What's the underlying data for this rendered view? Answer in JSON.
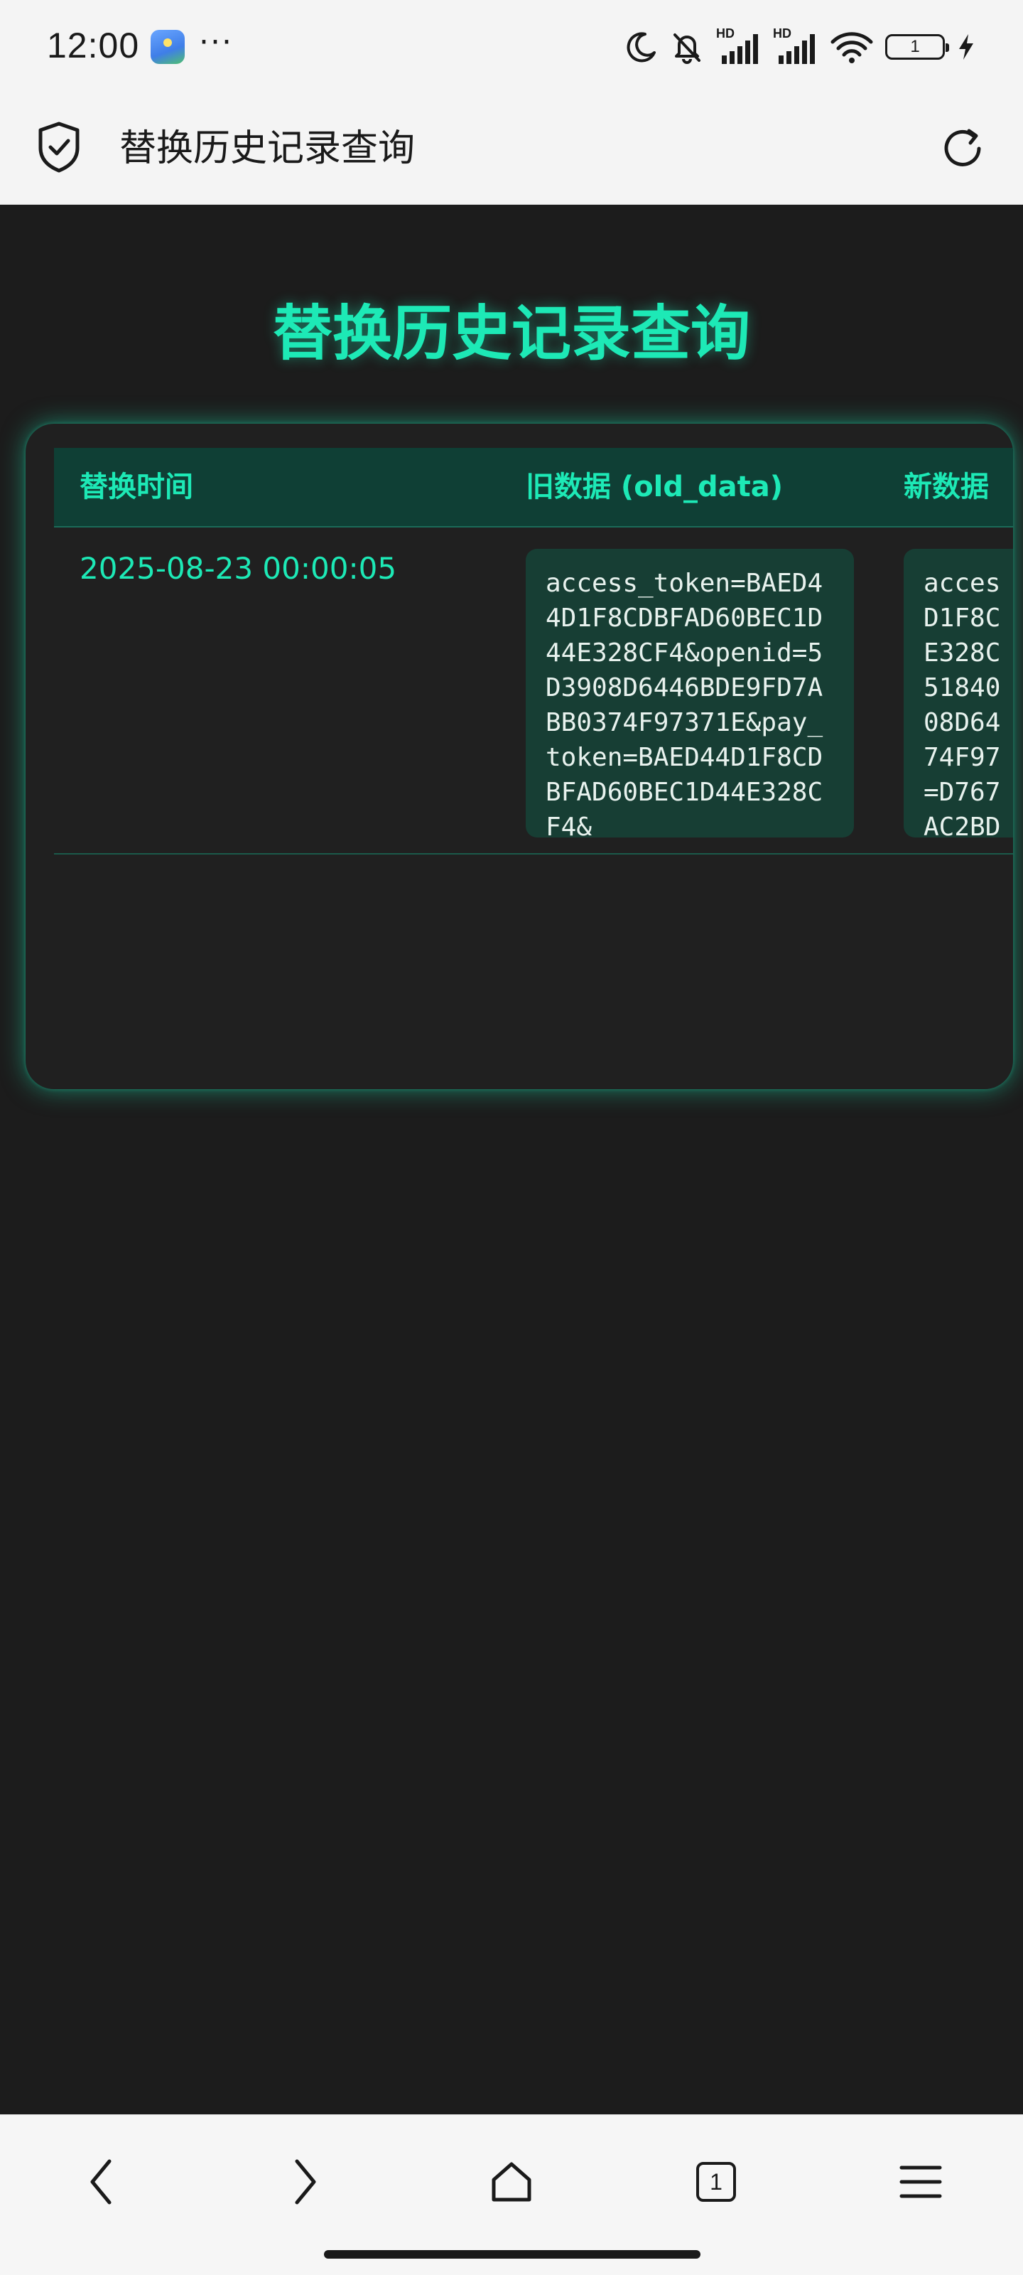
{
  "status_bar": {
    "time": "12:00",
    "more_dots": "···",
    "hd_label_1": "HD",
    "hd_label_2": "HD",
    "battery_level": "1"
  },
  "title_bar": {
    "title": "替换历史记录查询",
    "left_icon": "shield-check-icon",
    "right_icon": "reload-icon"
  },
  "page": {
    "heading": "替换历史记录查询",
    "accent_color": "#1de9b6",
    "background_color": "#1c1c1c",
    "table": {
      "headers": {
        "time": "替换时间",
        "old_data": "旧数据 (old_data)",
        "new_data": "新数据"
      },
      "rows": [
        {
          "time": "2025-08-23 00:00:05",
          "old_data": "access_token=BAED44D1F8CDBFAD60BEC1D44E328CF4&openid=5D3908D6446BDE9FD7ABB0374F97371E&pay_token=BAED44D1F8CDBFAD60BEC1D44E328CF4&",
          "new_data": "acces\nD1F8C\nE328C\n51840\n08D64\n74F97\n=D767\nAC2BD"
        }
      ]
    }
  },
  "bottom_nav": {
    "back_icon": "chevron-left-icon",
    "forward_icon": "chevron-right-icon",
    "home_icon": "home-icon",
    "tab_count": "1",
    "menu_icon": "hamburger-menu-icon"
  }
}
